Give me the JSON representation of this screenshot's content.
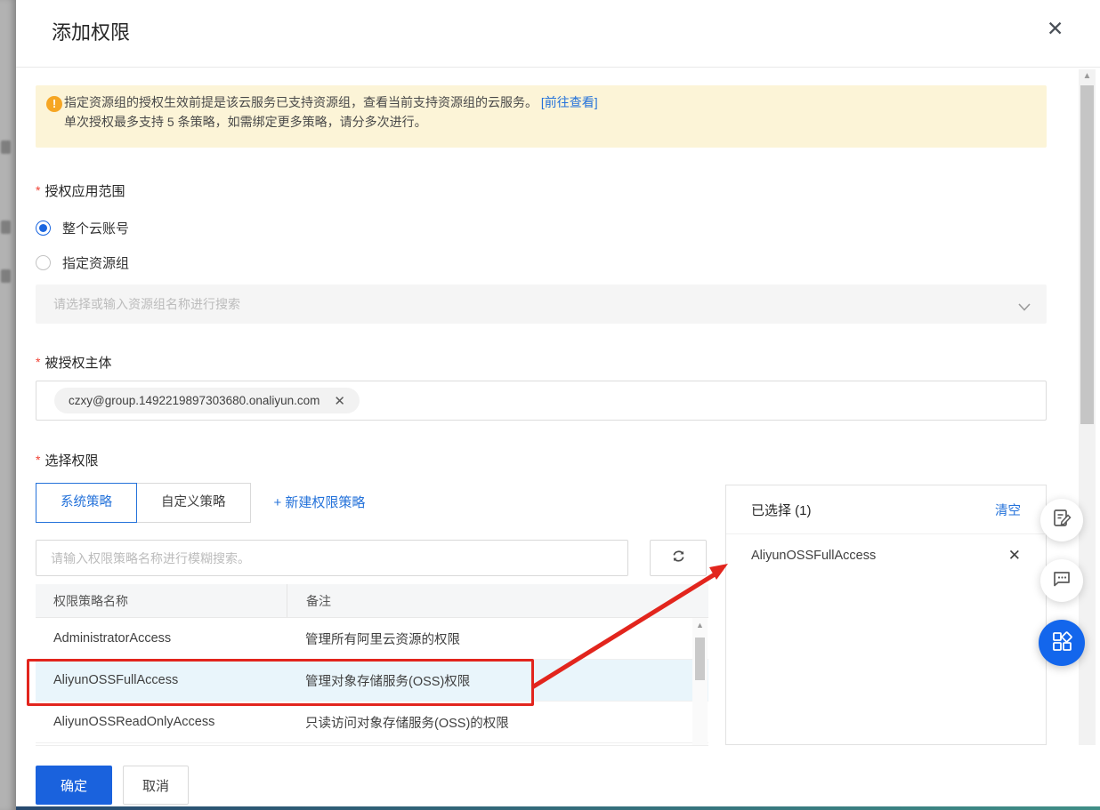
{
  "dialog": {
    "title": "添加权限"
  },
  "icons": {
    "close": "✕",
    "warning": "!",
    "remove": "✕",
    "scroll_up": "▲"
  },
  "misc": {
    "required_mark": "*"
  },
  "banner": {
    "line1": "指定资源组的授权生效前提是该云服务已支持资源组，查看当前支持资源组的云服务。",
    "link": "[前往查看]",
    "line2": "单次授权最多支持 5 条策略，如需绑定更多策略，请分多次进行。"
  },
  "scope": {
    "label": "授权应用范围",
    "options": [
      {
        "label": "整个云账号",
        "selected": true
      },
      {
        "label": "指定资源组",
        "selected": false
      }
    ],
    "resource_group_placeholder": "请选择或输入资源组名称进行搜索"
  },
  "principal": {
    "label": "被授权主体",
    "tag": "czxy@group.1492219897303680.onaliyun.com"
  },
  "permissions": {
    "label": "选择权限",
    "tabs": [
      {
        "label": "系统策略",
        "active": true
      },
      {
        "label": "自定义策略",
        "active": false
      }
    ],
    "new_policy_link": "+ 新建权限策略",
    "search_placeholder": "请输入权限策略名称进行模糊搜索。",
    "table": {
      "columns": [
        "权限策略名称",
        "备注"
      ],
      "rows": [
        {
          "name": "AdministratorAccess",
          "note": "管理所有阿里云资源的权限",
          "selected": false
        },
        {
          "name": "AliyunOSSFullAccess",
          "note": "管理对象存储服务(OSS)权限",
          "selected": true
        },
        {
          "name": "AliyunOSSReadOnlyAccess",
          "note": "只读访问对象存储服务(OSS)的权限",
          "selected": false
        }
      ]
    },
    "selected_panel": {
      "title": "已选择 (1)",
      "clear_label": "清空",
      "items": [
        "AliyunOSSFullAccess"
      ]
    }
  },
  "footer": {
    "ok_label": "确定",
    "cancel_label": "取消"
  },
  "colors": {
    "accent_blue": "#2472da",
    "primary_button_blue": "#1a62dd",
    "float_button_blue": "#1366ec",
    "banner_bg": "#fcf4d7",
    "banner_icon_orange": "#f6a623",
    "annotation_red": "#e2251d",
    "selected_row_bg": "#e9f5fb"
  }
}
